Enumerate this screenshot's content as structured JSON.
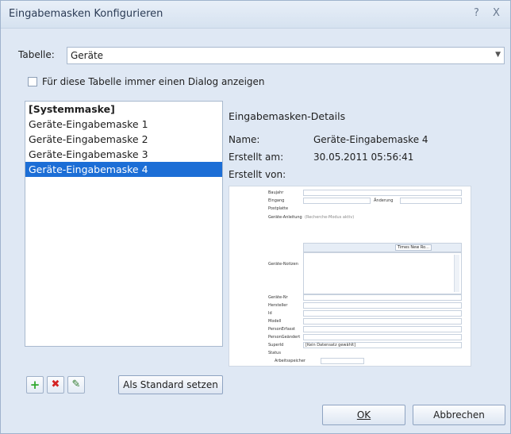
{
  "window": {
    "title": "Eingabemasken Konfigurieren",
    "help_glyph": "?",
    "close_glyph": "X"
  },
  "table_row": {
    "label": "Tabelle:",
    "selected_value": "Geräte"
  },
  "dialog_checkbox": {
    "label": "Für diese Tabelle immer einen Dialog anzeigen",
    "checked": false
  },
  "masks_list": {
    "items": [
      {
        "label": "[Systemmaske]",
        "bold": true,
        "selected": false
      },
      {
        "label": "Geräte-Eingabemaske 1",
        "bold": false,
        "selected": false
      },
      {
        "label": "Geräte-Eingabemaske 2",
        "bold": false,
        "selected": false
      },
      {
        "label": "Geräte-Eingabemaske 3",
        "bold": false,
        "selected": false
      },
      {
        "label": "Geräte-Eingabemaske 4",
        "bold": false,
        "selected": true
      }
    ]
  },
  "details": {
    "title": "Eingabemasken-Details",
    "name_label": "Name:",
    "name_value": "Geräte-Eingabemaske 4",
    "created_at_label": "Erstellt am:",
    "created_at_value": "30.05.2011 05:56:41",
    "created_by_label": "Erstellt von:",
    "created_by_value": ""
  },
  "preview": {
    "fields": [
      "Baujahr",
      "Eingang",
      "Postplatte",
      "Geräte-Anleitung",
      "Geräte-Notizen",
      "Geräte-Nr",
      "Hersteller",
      "Id",
      "Modell",
      "PersonErfasst",
      "PersonGeändert",
      "SuperId",
      "Status",
      "Arbeitsspeicher"
    ],
    "change_label": "Änderung",
    "recherche_text": "(Recherche-Modus aktiv)",
    "font_name": "Times New Ro...",
    "superid_value": "[Kein Datensatz gewählt]"
  },
  "buttons": {
    "set_default": "Als Standard setzen",
    "ok": "OK",
    "cancel": "Abbrechen"
  },
  "icons": {
    "add": "+",
    "delete": "✖",
    "edit": "✎"
  },
  "colors": {
    "selection": "#1c6ed6",
    "add": "#2ea82e",
    "delete": "#d42323"
  }
}
